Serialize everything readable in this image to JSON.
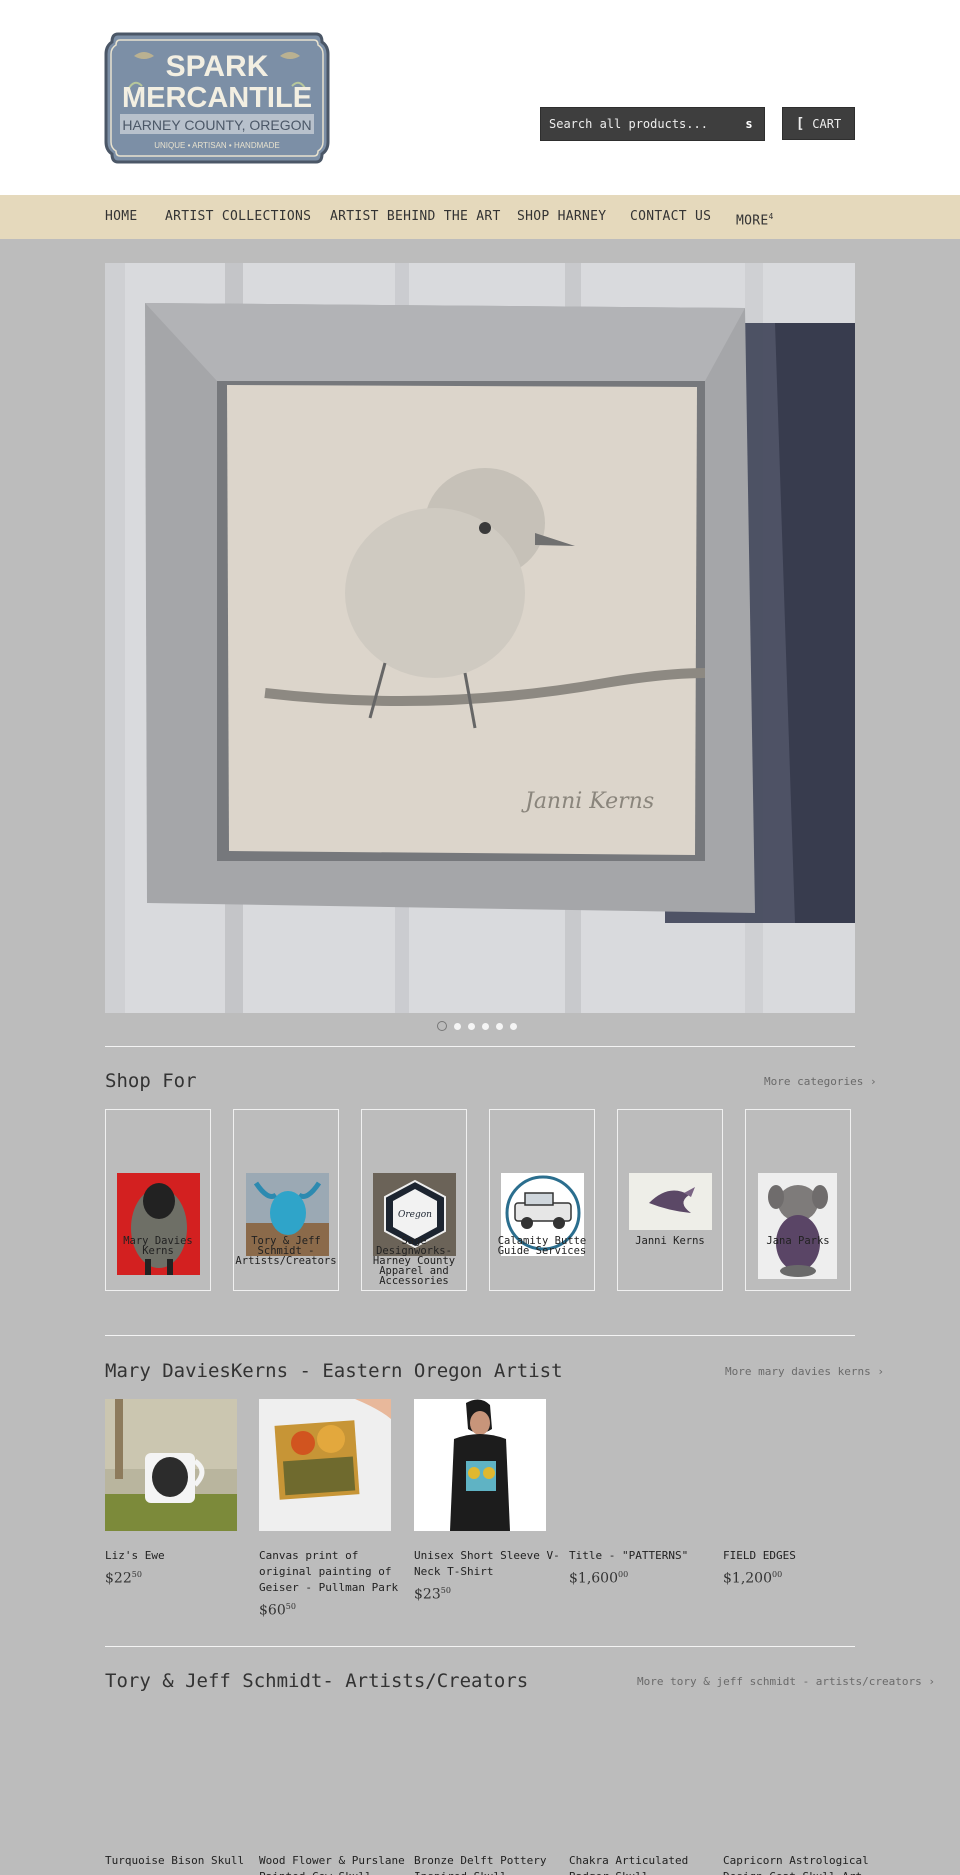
{
  "brand": {
    "logo_line1": "SPARK",
    "logo_line2": "MERCANTILE",
    "logo_line3": "HARNEY COUNTY, OREGON",
    "logo_line4": "UNIQUE • ARTISAN • HANDMADE"
  },
  "search": {
    "placeholder": "Search all products..."
  },
  "cart": {
    "label": "CART"
  },
  "nav": {
    "items": [
      {
        "label": "HOME"
      },
      {
        "label": "ARTIST COLLECTIONS"
      },
      {
        "label": "ARTIST BEHIND THE ART"
      },
      {
        "label": "SHOP HARNEY"
      },
      {
        "label": "CONTACT US"
      },
      {
        "label": "MORE"
      }
    ]
  },
  "slideshow": {
    "signature": "Janni Kerns",
    "dots_count": 6,
    "active_dot": 1
  },
  "shop_for": {
    "title": "Shop For",
    "more": "More categories ›",
    "categories": [
      {
        "label": "Mary Davies Kerns"
      },
      {
        "label": "Tory & Jeff Schmidt - Artists/Creators"
      },
      {
        "label": "Sage Designworks- Harney County Apparel and Accessories"
      },
      {
        "label": "Calamity Butte Guide Services"
      },
      {
        "label": "Janni Kerns"
      },
      {
        "label": "Jana Parks"
      }
    ]
  },
  "collection1": {
    "title": "Mary DaviesKerns - Eastern Oregon Artist",
    "more": "More mary davies kerns ›",
    "products": [
      {
        "title": "Liz's Ewe",
        "price_main": "$22",
        "price_cents": "50"
      },
      {
        "title": "Canvas print of original painting of Geiser - Pullman Park",
        "price_main": "$60",
        "price_cents": "50"
      },
      {
        "title": "Unisex Short Sleeve V-Neck T-Shirt",
        "price_main": "$23",
        "price_cents": "50"
      },
      {
        "title": "Title - \"PATTERNS\"",
        "price_main": "$1,600",
        "price_cents": "00"
      },
      {
        "title": "FIELD EDGES",
        "price_main": "$1,200",
        "price_cents": "00"
      }
    ]
  },
  "collection2": {
    "title": "Tory & Jeff Schmidt- Artists/Creators",
    "more": "More tory & jeff schmidt - artists/creators ›",
    "products": [
      {
        "title": "Turquoise Bison Skull"
      },
      {
        "title": "Wood Flower & Purslane Painted Cow Skull"
      },
      {
        "title": "Bronze Delft Pottery Inspired Skull"
      },
      {
        "title": "Chakra Articulated Badger Skull"
      },
      {
        "title": "Capricorn Astrological Design Goat Skull Art"
      }
    ]
  },
  "colors": {
    "page_bg": "#bcbcbc",
    "nav_bg": "#e5d9bc",
    "button_bg": "#3e3e3e",
    "logo_blue": "#7c8fa6"
  }
}
